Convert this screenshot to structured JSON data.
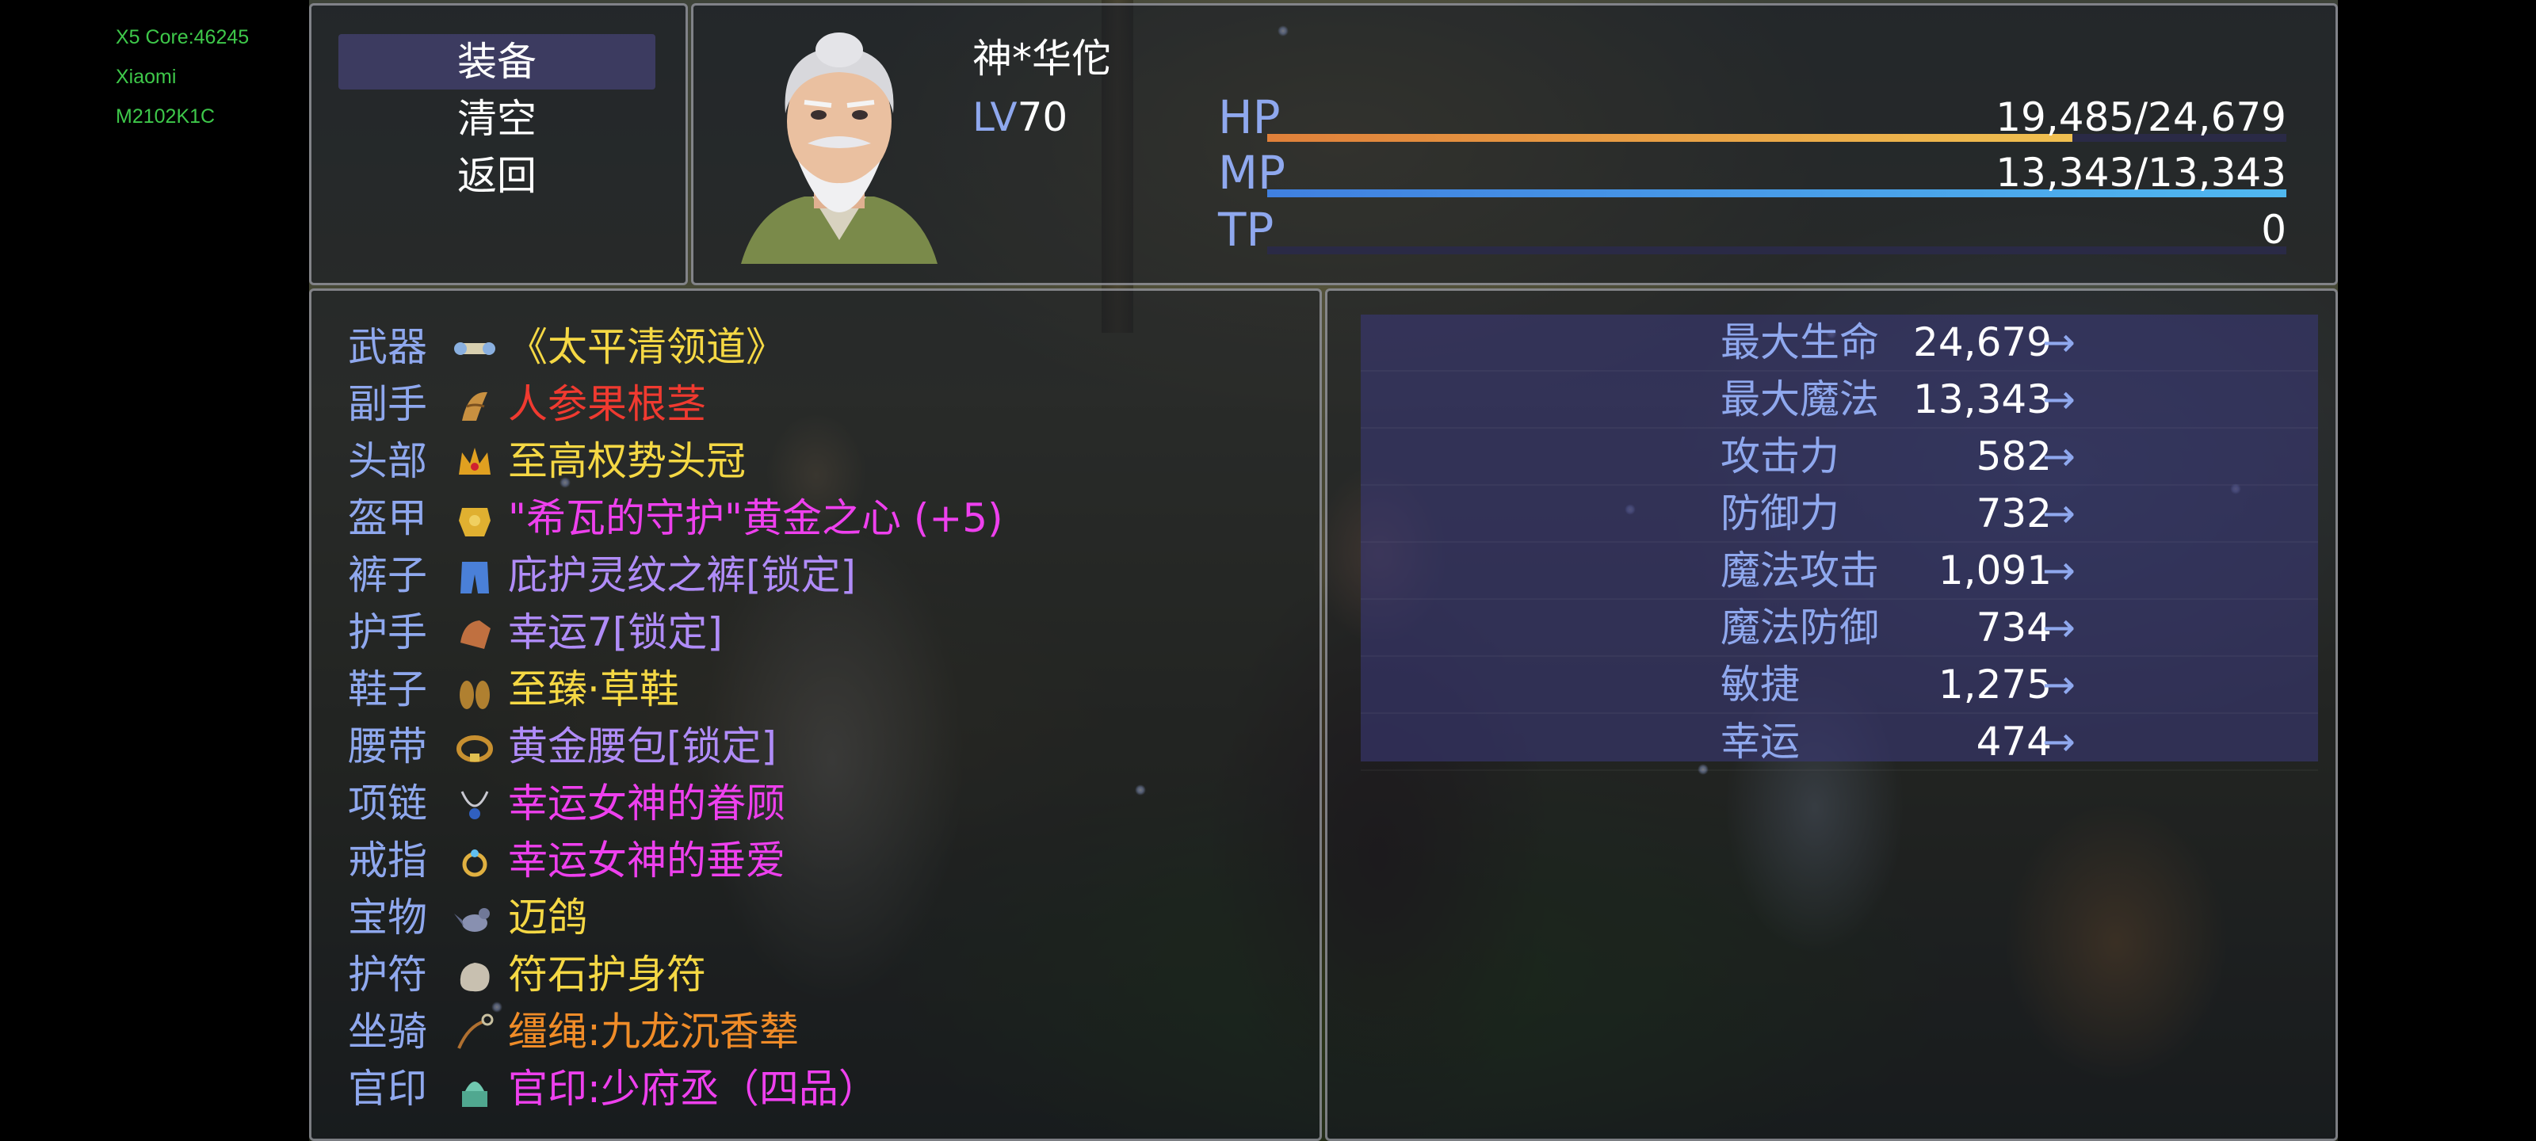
{
  "device_overlay": [
    "X5 Core:46245",
    "Xiaomi",
    "M2102K1C"
  ],
  "commands": [
    "装备",
    "清空",
    "返回"
  ],
  "actor": {
    "name": "神*华佗",
    "level_label": "LV",
    "level": "70",
    "hp": {
      "label": "HP",
      "value": "19,485/24,679",
      "fraction": 0.79,
      "colors": [
        "#e0803a",
        "#f0c050"
      ]
    },
    "mp": {
      "label": "MP",
      "value": "13,343/13,343",
      "fraction": 1.0,
      "colors": [
        "#4080e0",
        "#50b8f0"
      ]
    },
    "tp": {
      "label": "TP",
      "value": "0",
      "fraction": 0.0,
      "colors": [
        "#50c060",
        "#a0e060"
      ]
    }
  },
  "equipment": [
    {
      "slot": "武器",
      "item": "《太平清领道》",
      "color": "#f5d844",
      "icon": "scroll-icon"
    },
    {
      "slot": "副手",
      "item": "人参果根茎",
      "color": "#f03a30",
      "icon": "root-icon"
    },
    {
      "slot": "头部",
      "item": "至高权势头冠",
      "color": "#f5d844",
      "icon": "crown-icon"
    },
    {
      "slot": "盔甲",
      "item": "\"希瓦的守护\"黄金之心 (+5)",
      "color": "#ee40ee",
      "icon": "armor-icon"
    },
    {
      "slot": "裤子",
      "item": "庇护灵纹之裤[锁定]",
      "color": "#b08cf8",
      "icon": "pants-icon"
    },
    {
      "slot": "护手",
      "item": "幸运7[锁定]",
      "color": "#b08cf8",
      "icon": "gauntlet-icon"
    },
    {
      "slot": "鞋子",
      "item": "至臻·草鞋",
      "color": "#f5d844",
      "icon": "sandals-icon"
    },
    {
      "slot": "腰带",
      "item": "黄金腰包[锁定]",
      "color": "#b08cf8",
      "icon": "belt-icon"
    },
    {
      "slot": "项链",
      "item": "幸运女神的眷顾",
      "color": "#ee40ee",
      "icon": "necklace-icon"
    },
    {
      "slot": "戒指",
      "item": "幸运女神的垂爱",
      "color": "#ee40ee",
      "icon": "ring-icon"
    },
    {
      "slot": "宝物",
      "item": "迈鸽",
      "color": "#f5d844",
      "icon": "pigeon-icon"
    },
    {
      "slot": "护符",
      "item": "符石护身符",
      "color": "#f5d844",
      "icon": "rune-stone-icon"
    },
    {
      "slot": "坐骑",
      "item": "缰绳:九龙沉香辇",
      "color": "#f08c28",
      "icon": "reins-icon"
    },
    {
      "slot": "官印",
      "item": "官印:少府丞（四品）",
      "color": "#ee40ee",
      "icon": "seal-icon"
    }
  ],
  "params": [
    {
      "name": "最大生命",
      "value": "24,679",
      "arrow": "→"
    },
    {
      "name": "最大魔法",
      "value": "13,343",
      "arrow": "→"
    },
    {
      "name": "攻击力",
      "value": "582",
      "arrow": "→"
    },
    {
      "name": "防御力",
      "value": "732",
      "arrow": "→"
    },
    {
      "name": "魔法攻击",
      "value": "1,091",
      "arrow": "→"
    },
    {
      "name": "魔法防御",
      "value": "734",
      "arrow": "→"
    },
    {
      "name": "敏捷",
      "value": "1,275",
      "arrow": "→"
    },
    {
      "name": "幸运",
      "value": "474",
      "arrow": "→"
    }
  ]
}
